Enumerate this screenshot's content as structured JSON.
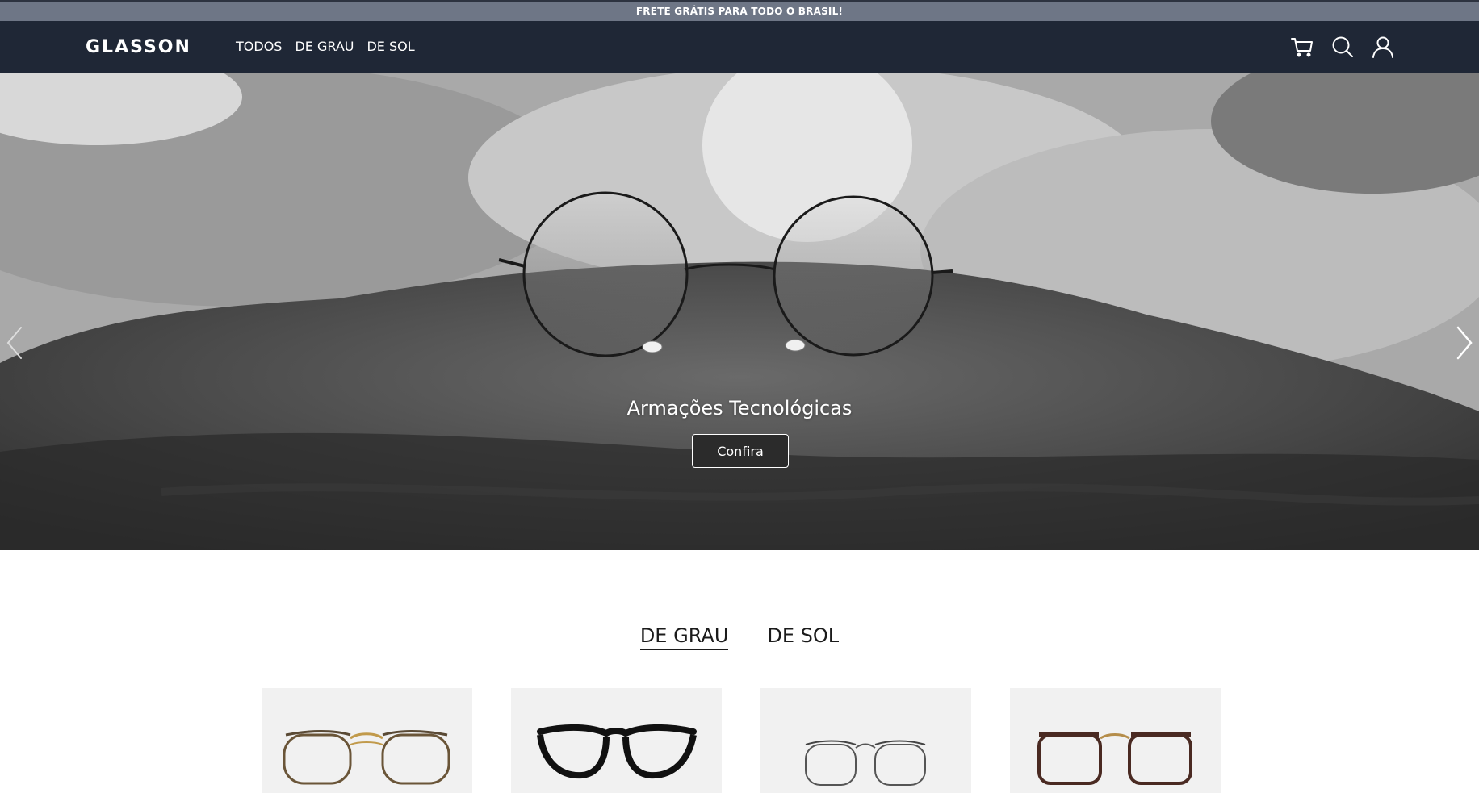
{
  "announcement": "FRETE GRÁTIS PARA TODO O BRASIL!",
  "brand": "GLASSON",
  "nav": {
    "links": [
      "TODOS",
      "DE GRAU",
      "DE SOL"
    ],
    "icons": [
      "cart-icon",
      "search-icon",
      "user-icon"
    ]
  },
  "hero": {
    "caption": "Armações Tecnológicas",
    "button": "Confira",
    "arrows": [
      "chevron-left-icon",
      "chevron-right-icon"
    ]
  },
  "tabs": {
    "items": [
      "DE GRAU",
      "DE SOL"
    ],
    "active": "DE GRAU"
  },
  "products": [
    {
      "name": "product-gold-frame"
    },
    {
      "name": "product-black-frame"
    },
    {
      "name": "product-silver-frame"
    },
    {
      "name": "product-brown-frame"
    }
  ],
  "colors": {
    "topbar": "#6e7686",
    "navbar": "#1f2736",
    "card": "#f1f1f1",
    "text": "#1b1b1b"
  }
}
